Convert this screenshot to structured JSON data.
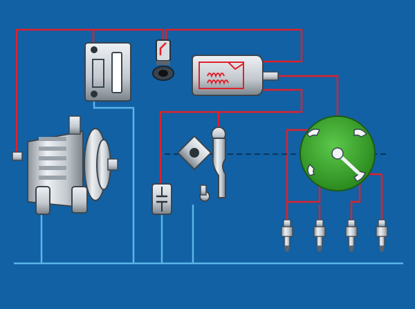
{
  "diagram": {
    "kind": "ignition-system-schematic",
    "components": [
      {
        "name": "alternator",
        "icon": "alternator-icon"
      },
      {
        "name": "battery",
        "icon": "battery-icon"
      },
      {
        "name": "ignition-switch",
        "icon": "key-switch-icon"
      },
      {
        "name": "ignition-coil",
        "icon": "coil-icon"
      },
      {
        "name": "contact-breaker",
        "icon": "breaker-points-icon"
      },
      {
        "name": "breaker-cam",
        "icon": "cam-icon"
      },
      {
        "name": "condenser",
        "icon": "capacitor-icon"
      },
      {
        "name": "distributor-cap",
        "icon": "distributor-icon"
      },
      {
        "name": "spark-plugs",
        "icon": "spark-plug-icon",
        "count": 4
      }
    ],
    "colors": {
      "background": "#1161a4",
      "live_wire": "#e0202a",
      "ground_wire": "#5ab4e8",
      "distributor": "#3aa12a",
      "metal": "#c9cfd6"
    }
  }
}
